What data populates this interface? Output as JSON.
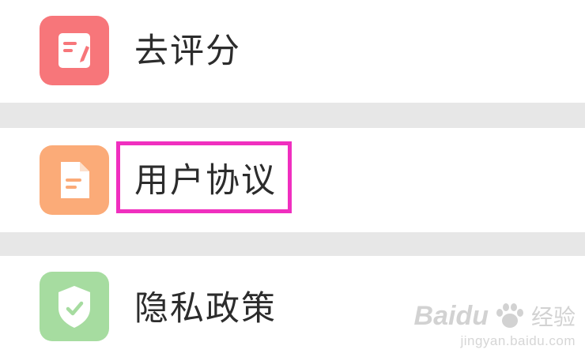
{
  "menu": {
    "items": [
      {
        "label": "去评分",
        "icon": "edit-note-icon",
        "color": "#f7767a"
      },
      {
        "label": "用户协议",
        "icon": "document-icon",
        "color": "#fbab78"
      },
      {
        "label": "隐私政策",
        "icon": "shield-check-icon",
        "color": "#a6dca0"
      }
    ],
    "highlighted_item": "用户协议"
  },
  "colors": {
    "highlight_border": "#f02fbf",
    "separator": "#e7e7e7"
  },
  "watermark": {
    "logo": "Baidu",
    "name": "经验",
    "url": "jingyan.baidu.com"
  }
}
